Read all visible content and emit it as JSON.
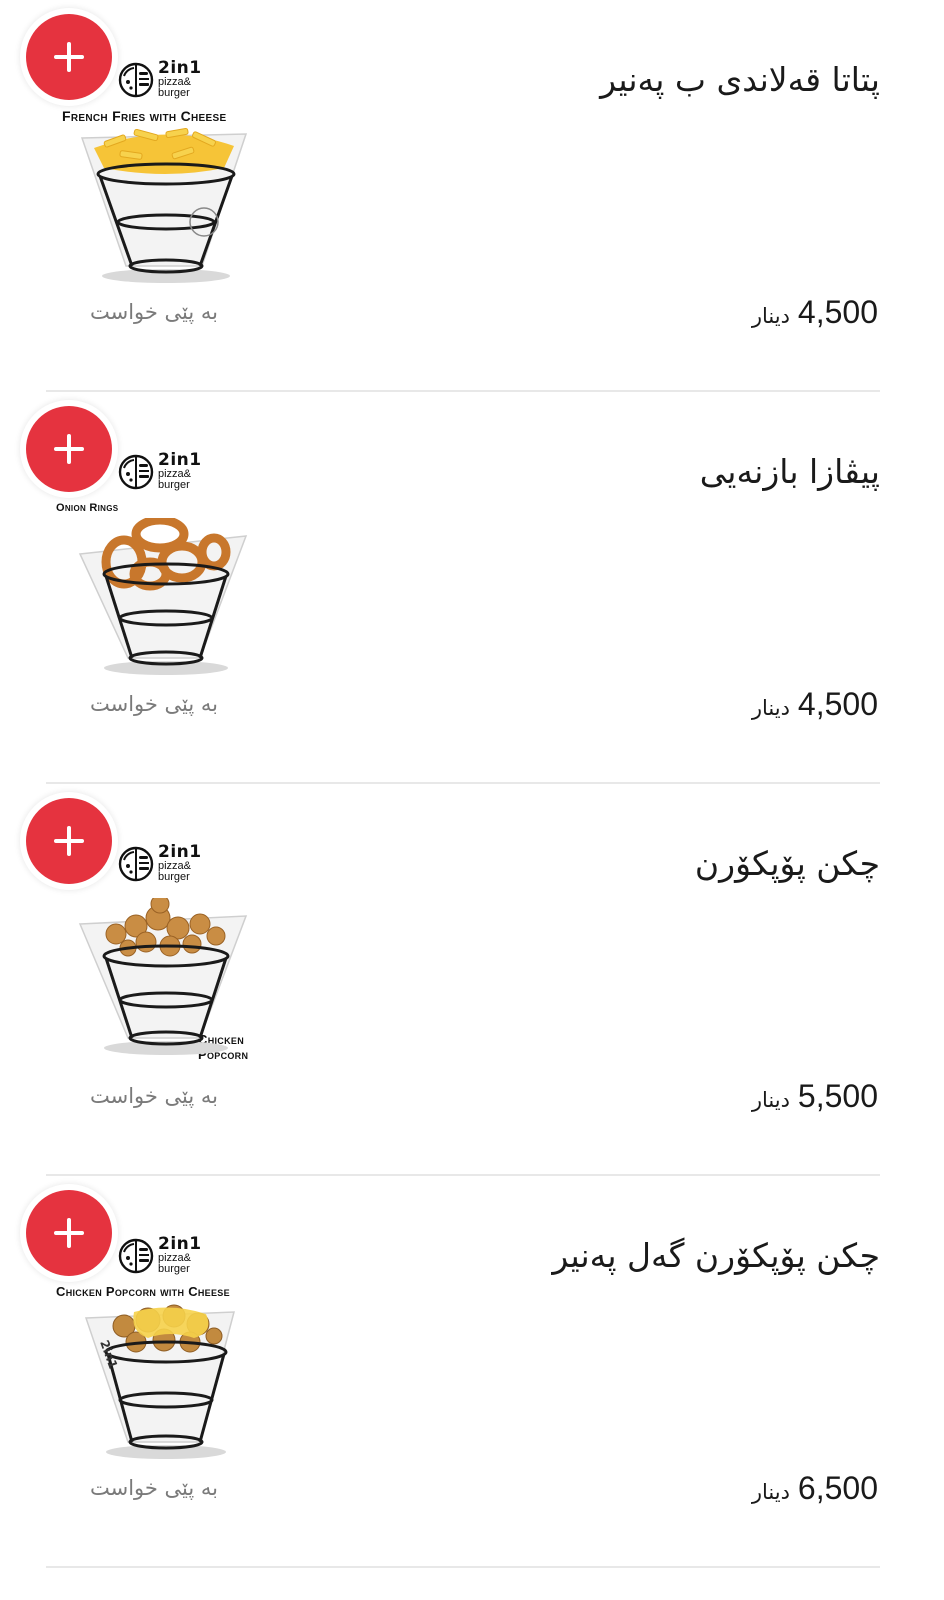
{
  "brand": {
    "big": "2in1",
    "small_line1": "pizza&",
    "small_line2": "burger"
  },
  "colors": {
    "accent": "#e5333f",
    "divider": "#e8e8e8",
    "text": "#1a1a1a",
    "muted": "#7a7a7a"
  },
  "items": [
    {
      "name": "پتاتا قەلاندی ب پەنیر",
      "price": "4,500",
      "currency": "دینار",
      "note": "بە پێی خواست",
      "image_caption": "French Fries with Cheese",
      "food": "fries"
    },
    {
      "name": "پیڤازا بازنەیی",
      "price": "4,500",
      "currency": "دینار",
      "note": "بە پێی خواست",
      "image_caption": "Onion Rings",
      "food": "rings"
    },
    {
      "name": "چکن پۆپکۆرن",
      "price": "5,500",
      "currency": "دینار",
      "note": "بە پێی خواست",
      "image_caption": "Chicken Popcorn",
      "food": "popcorn"
    },
    {
      "name": "چکن پۆپکۆرن گەل پەنیر",
      "price": "6,500",
      "currency": "دینار",
      "note": "بە پێی خواست",
      "image_caption": "Chicken Popcorn with Cheese",
      "food": "popcorn-cheese"
    }
  ],
  "icons": {
    "add": "plus-icon"
  }
}
